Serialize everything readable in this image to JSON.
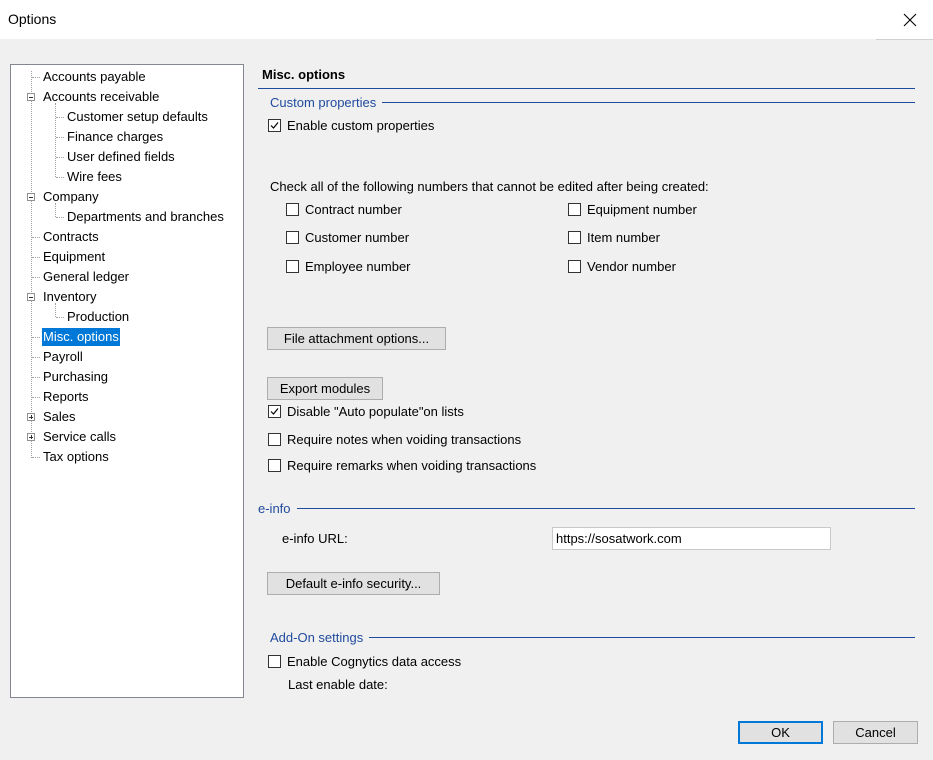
{
  "window": {
    "title": "Options"
  },
  "tree": {
    "items": [
      "Accounts payable",
      "Accounts receivable",
      "Customer setup defaults",
      "Finance charges",
      "User defined fields",
      "Wire fees",
      "Company",
      "Departments and branches",
      "Contracts",
      "Equipment",
      "General ledger",
      "Inventory",
      "Production",
      "Misc. options",
      "Payroll",
      "Purchasing",
      "Reports",
      "Sales",
      "Service calls",
      "Tax options"
    ],
    "selected": "Misc. options"
  },
  "panel": {
    "title": "Misc. options",
    "custom_properties": {
      "label": "Custom properties",
      "enable_label": "Enable custom properties",
      "enable_checked": true
    },
    "non_editable": {
      "prompt": "Check all of the following numbers that cannot be edited after being created:",
      "options": [
        {
          "label": "Contract number",
          "checked": false
        },
        {
          "label": "Customer number",
          "checked": false
        },
        {
          "label": "Employee number",
          "checked": false
        },
        {
          "label": "Equipment number",
          "checked": false
        },
        {
          "label": "Item number",
          "checked": false
        },
        {
          "label": "Vendor number",
          "checked": false
        }
      ]
    },
    "file_attachment_button": "File attachment options...",
    "export_modules_button": "Export modules",
    "disable_auto_populate": {
      "label": "Disable \"Auto populate\"on lists",
      "checked": true
    },
    "require_notes": {
      "label": "Require notes when voiding transactions",
      "checked": false
    },
    "require_remarks": {
      "label": "Require remarks when voiding transactions",
      "checked": false
    },
    "einfo": {
      "label": "e-info",
      "url_label": "e-info URL:",
      "url_value": "https://sosatwork.com",
      "security_button": "Default e-info security..."
    },
    "addon": {
      "label": "Add-On settings",
      "cognytics_label": "Enable Cognytics data access",
      "cognytics_checked": false,
      "last_enable_label": "Last enable date:"
    }
  },
  "footer": {
    "ok": "OK",
    "cancel": "Cancel"
  }
}
